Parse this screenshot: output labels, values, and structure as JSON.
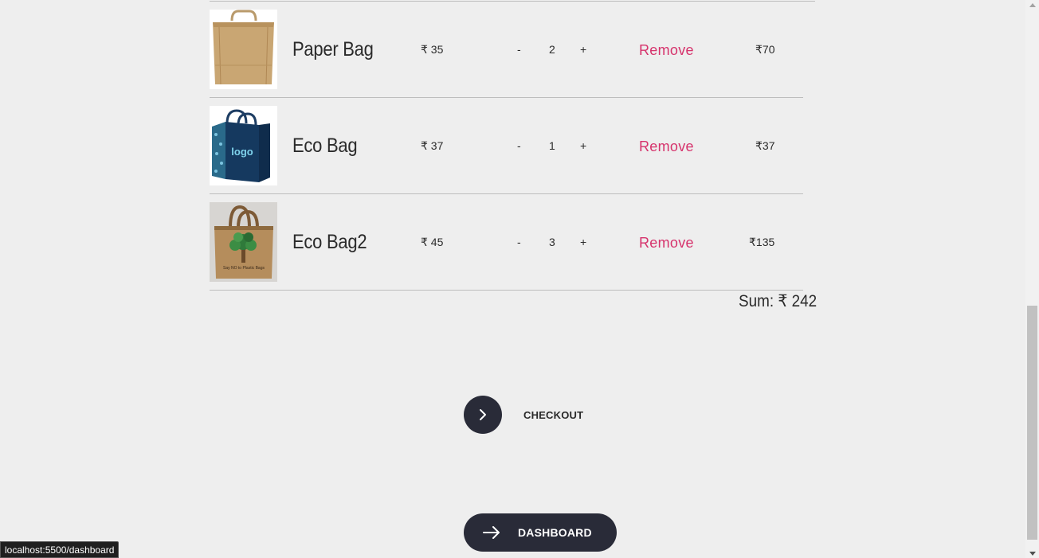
{
  "cart": {
    "items": [
      {
        "name": "Paper Bag",
        "price": "₹ 35",
        "quantity": "2",
        "minus": "-",
        "plus": "+",
        "remove_label": "Remove",
        "total": "₹70",
        "image_icon": "paper-bag-image"
      },
      {
        "name": "Eco Bag",
        "price": "₹ 37",
        "quantity": "1",
        "minus": "-",
        "plus": "+",
        "remove_label": "Remove",
        "total": "₹37",
        "image_icon": "eco-bag-image",
        "image_text": "logo"
      },
      {
        "name": "Eco Bag2",
        "price": "₹ 45",
        "quantity": "3",
        "minus": "-",
        "plus": "+",
        "remove_label": "Remove",
        "total": "₹135",
        "image_icon": "eco-bag2-image",
        "image_text": "Say NO to Plastic Bags"
      }
    ],
    "sum_text": "Sum: ₹ 242"
  },
  "actions": {
    "checkout_label": "CHECKOUT",
    "dashboard_label": "DASHBOARD"
  },
  "status_bar": {
    "url": "localhost:5500/dashboard"
  },
  "colors": {
    "background": "#eeeeee",
    "remove": "#d6336c",
    "button_dark": "#292b38",
    "divider": "#bdbdbd"
  }
}
